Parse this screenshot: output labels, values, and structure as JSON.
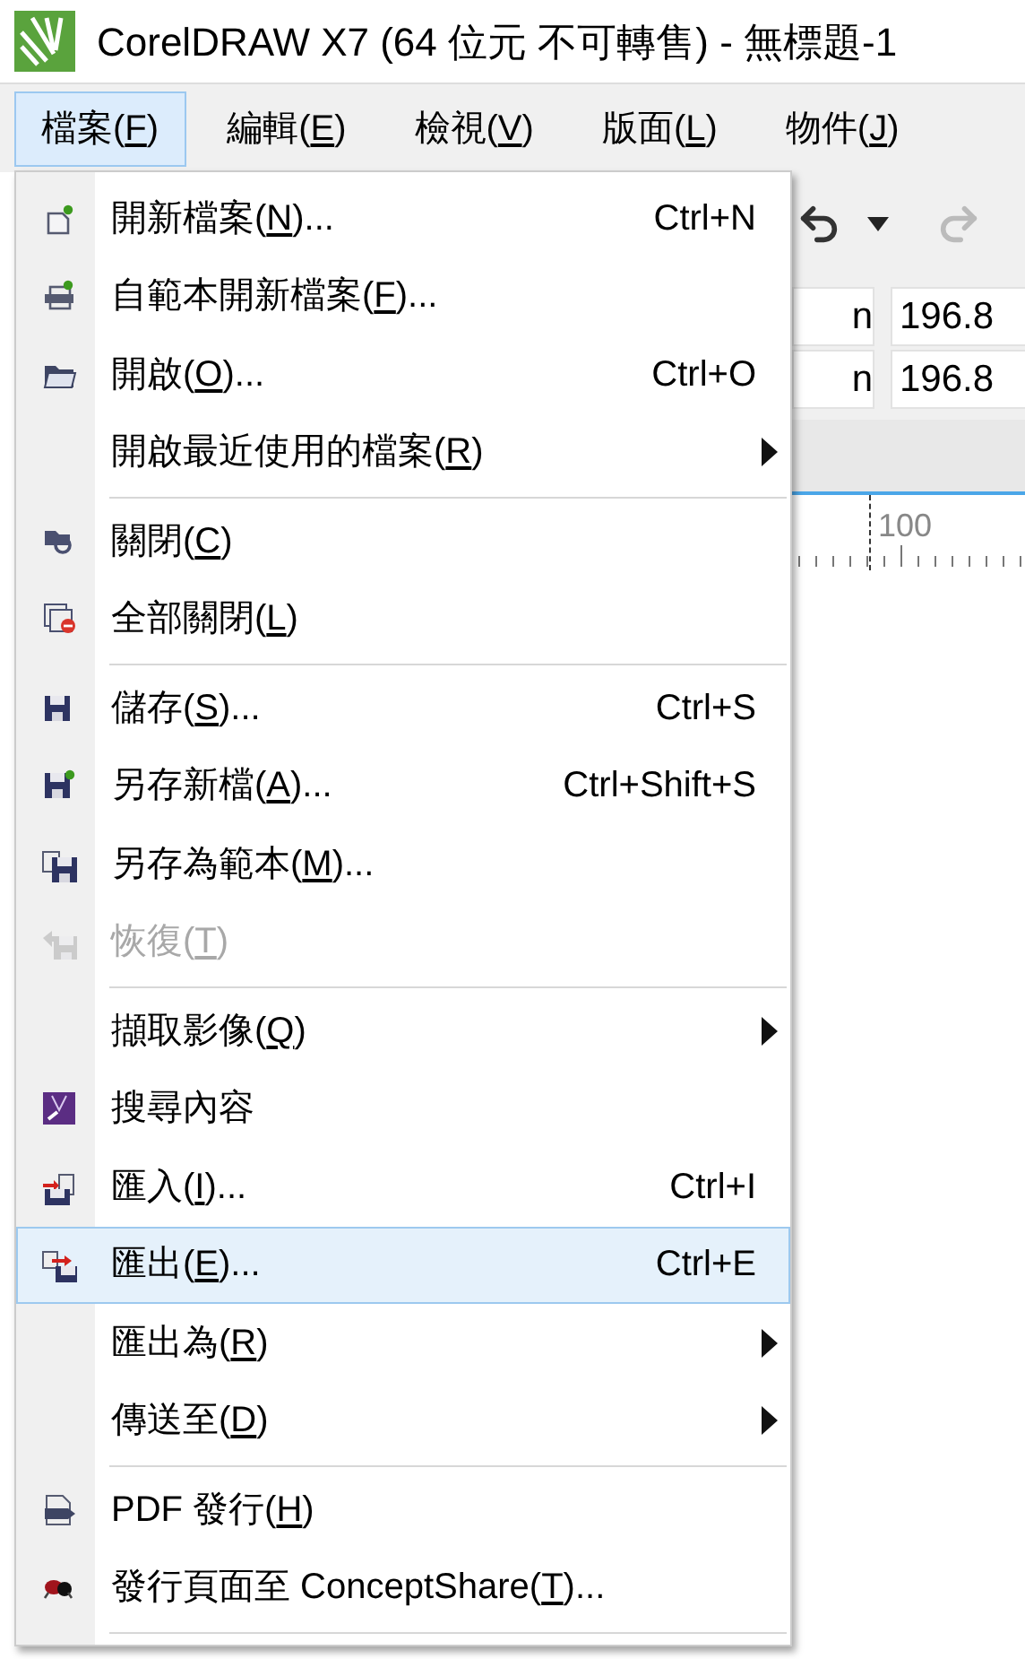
{
  "window": {
    "title": "CorelDRAW X7 (64 位元 不可轉售) - 無標題-1"
  },
  "menubar": [
    {
      "label": "檔案(",
      "mnemonic": "F",
      "label_end": ")",
      "selected": true
    },
    {
      "label": "編輯(",
      "mnemonic": "E",
      "label_end": ")",
      "selected": false
    },
    {
      "label": "檢視(",
      "mnemonic": "V",
      "label_end": ")",
      "selected": false
    },
    {
      "label": "版面(",
      "mnemonic": "L",
      "label_end": ")",
      "selected": false
    },
    {
      "label": "物件(",
      "mnemonic": "J",
      "label_end": ")",
      "selected": false
    }
  ],
  "toolbar": {
    "fields": [
      [
        "n",
        "196.8"
      ],
      [
        "n",
        "196.8"
      ]
    ],
    "ruler_label": "100"
  },
  "menu": [
    {
      "kind": "item",
      "label": "開新檔案(",
      "mnemonic": "N",
      "label_end": ")...",
      "shortcut": "Ctrl+N",
      "submenu": false,
      "disabled": false,
      "selected": false
    },
    {
      "kind": "item",
      "label": "自範本開新檔案(",
      "mnemonic": "F",
      "label_end": ")...",
      "submenu": false,
      "disabled": false,
      "selected": false
    },
    {
      "kind": "item",
      "label": "開啟(",
      "mnemonic": "O",
      "label_end": ")...",
      "shortcut": "Ctrl+O",
      "submenu": false,
      "disabled": false,
      "selected": false
    },
    {
      "kind": "item",
      "label": "開啟最近使用的檔案(",
      "mnemonic": "R",
      "label_end": ")",
      "submenu": true,
      "disabled": false,
      "selected": false
    },
    {
      "kind": "separator"
    },
    {
      "kind": "item",
      "label": "關閉(",
      "mnemonic": "C",
      "label_end": ")",
      "submenu": false,
      "disabled": false,
      "selected": false
    },
    {
      "kind": "item",
      "label": "全部關閉(",
      "mnemonic": "L",
      "label_end": ")",
      "submenu": false,
      "disabled": false,
      "selected": false
    },
    {
      "kind": "separator"
    },
    {
      "kind": "item",
      "label": "儲存(",
      "mnemonic": "S",
      "label_end": ")...",
      "shortcut": "Ctrl+S",
      "submenu": false,
      "disabled": false,
      "selected": false
    },
    {
      "kind": "item",
      "label": "另存新檔(",
      "mnemonic": "A",
      "label_end": ")...",
      "shortcut": "Ctrl+Shift+S",
      "submenu": false,
      "disabled": false,
      "selected": false
    },
    {
      "kind": "item",
      "label": "另存為範本(",
      "mnemonic": "M",
      "label_end": ")...",
      "submenu": false,
      "disabled": false,
      "selected": false
    },
    {
      "kind": "item",
      "label": "恢復(",
      "mnemonic": "T",
      "label_end": ")",
      "submenu": false,
      "disabled": true,
      "selected": false
    },
    {
      "kind": "separator"
    },
    {
      "kind": "item",
      "label": "擷取影像(",
      "mnemonic": "Q",
      "label_end": ")",
      "submenu": true,
      "disabled": false,
      "selected": false
    },
    {
      "kind": "item",
      "label": "搜尋內容",
      "submenu": false,
      "disabled": false,
      "selected": false
    },
    {
      "kind": "item",
      "label": "匯入(",
      "mnemonic": "I",
      "label_end": ")...",
      "shortcut": "Ctrl+I",
      "submenu": false,
      "disabled": false,
      "selected": false
    },
    {
      "kind": "item",
      "label": "匯出(",
      "mnemonic": "E",
      "label_end": ")...",
      "shortcut": "Ctrl+E",
      "submenu": false,
      "disabled": false,
      "selected": true
    },
    {
      "kind": "item",
      "label": "匯出為(",
      "mnemonic": "R",
      "label_end": ")",
      "submenu": true,
      "disabled": false,
      "selected": false
    },
    {
      "kind": "item",
      "label": "傳送至(",
      "mnemonic": "D",
      "label_end": ")",
      "submenu": true,
      "disabled": false,
      "selected": false
    },
    {
      "kind": "separator"
    },
    {
      "kind": "item",
      "label": "PDF 發行(",
      "mnemonic": "H",
      "label_end": ")",
      "submenu": false,
      "disabled": false,
      "selected": false
    },
    {
      "kind": "item",
      "label": "發行頁面至 ConceptShare(",
      "mnemonic": "T",
      "label_end": ")...",
      "submenu": false,
      "disabled": false,
      "selected": false
    },
    {
      "kind": "separator"
    }
  ]
}
